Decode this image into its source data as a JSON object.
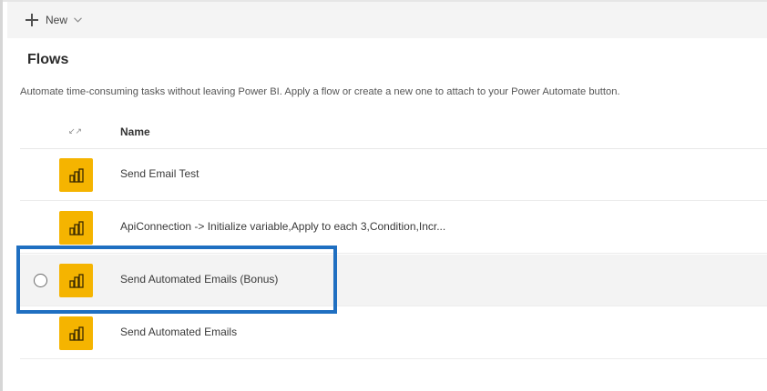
{
  "toolbar": {
    "new_label": "New",
    "new_icon": "plus-icon",
    "chevron_icon": "chevron-down-icon"
  },
  "page": {
    "title": "Flows",
    "description": "Automate time-consuming tasks without leaving Power BI. Apply a flow or create a new one to attach to your Power Automate button."
  },
  "table": {
    "sort_glyph": "↙↗",
    "columns": {
      "name": "Name"
    },
    "rows": [
      {
        "name": "Send Email Test",
        "icon": "flow-icon",
        "selected": false
      },
      {
        "name": "ApiConnection -> Initialize variable,Apply to each 3,Condition,Incr...",
        "icon": "flow-icon",
        "selected": false
      },
      {
        "name": "Send Automated Emails (Bonus)",
        "icon": "flow-icon",
        "selected": true
      },
      {
        "name": "Send Automated Emails",
        "icon": "flow-icon",
        "selected": false
      }
    ]
  },
  "colors": {
    "flow_icon_bg": "#f5b400",
    "highlight_border": "#1f6fc1",
    "toolbar_bg": "#f4f4f4",
    "selected_row_bg": "#f3f3f3"
  }
}
